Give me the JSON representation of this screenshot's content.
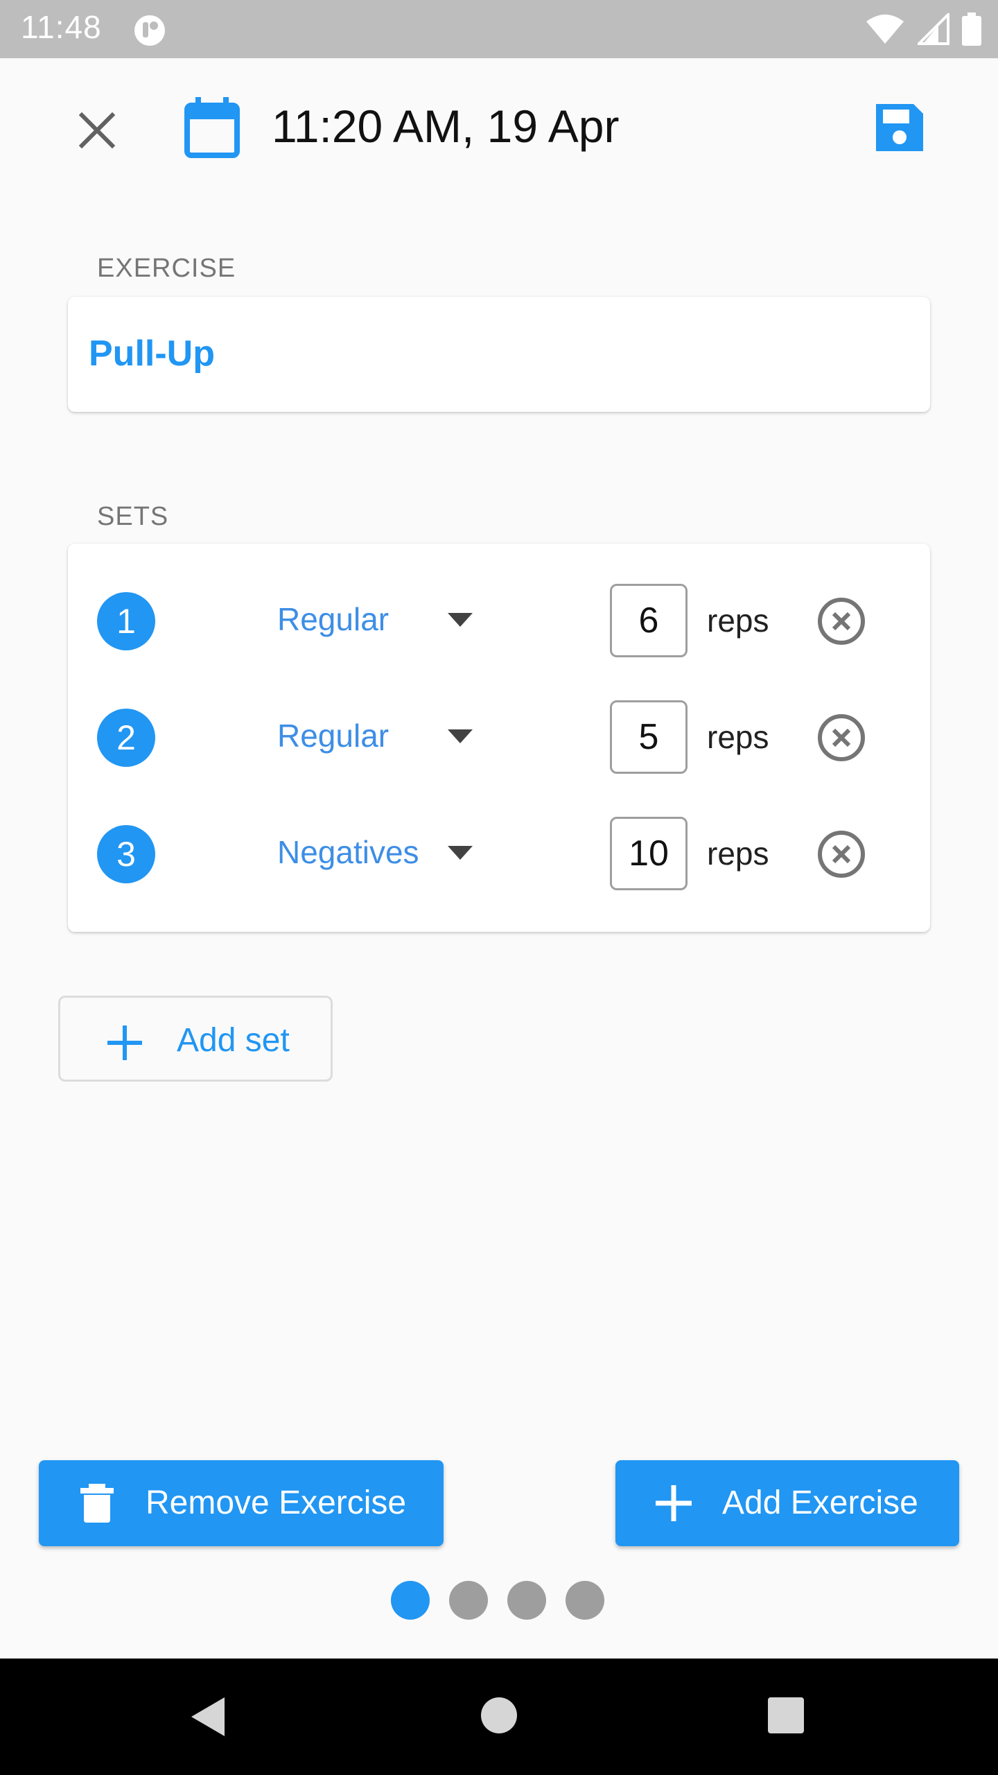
{
  "status_bar": {
    "time": "11:48",
    "icons": [
      "app-notification-icon",
      "wifi-icon",
      "signal-icon",
      "battery-icon"
    ]
  },
  "header": {
    "title": "11:20 AM, 19 Apr",
    "icons": [
      "close-icon",
      "calendar-icon",
      "save-icon"
    ]
  },
  "exercise_section": {
    "label": "EXERCISE",
    "name": "Pull-Up"
  },
  "sets_section": {
    "label": "SETS",
    "sets": [
      {
        "number": "1",
        "type": "Regular",
        "reps": "6",
        "unit": "reps"
      },
      {
        "number": "2",
        "type": "Regular",
        "reps": "5",
        "unit": "reps"
      },
      {
        "number": "3",
        "type": "Negatives",
        "reps": "10",
        "unit": "reps"
      }
    ]
  },
  "add_set_label": "Add set",
  "bottom_actions": {
    "remove_label": "Remove Exercise",
    "add_label": "Add Exercise"
  },
  "pager": {
    "total": 4,
    "active_index": 0
  },
  "colors": {
    "accent": "#2196f3",
    "status_bar": "#bdbdbd",
    "background": "#fafafa"
  }
}
